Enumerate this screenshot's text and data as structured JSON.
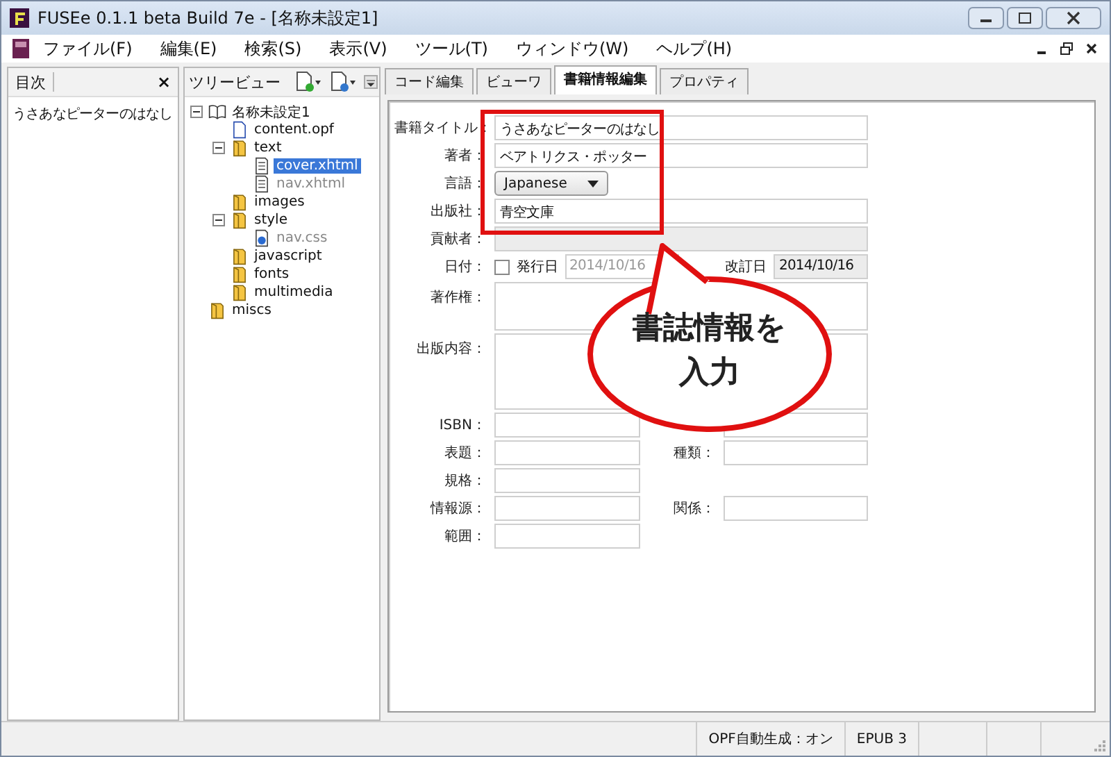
{
  "window": {
    "title": "FUSEe 0.1.1 beta Build 7e - [名称未設定1]"
  },
  "menu": [
    "ファイル(F)",
    "編集(E)",
    "検索(S)",
    "表示(V)",
    "ツール(T)",
    "ウィンドウ(W)",
    "ヘルプ(H)"
  ],
  "toc_pane": {
    "title": "目次",
    "close": "×",
    "items": [
      "うさあなピーターのはなし"
    ]
  },
  "tree_pane": {
    "title": "ツリービュー",
    "tree": [
      {
        "label": "名称未設定1",
        "kind": "book",
        "selected": false,
        "muted": false,
        "expanded": true,
        "children": [
          {
            "label": "content.opf",
            "kind": "file",
            "selected": false,
            "muted": false
          },
          {
            "label": "text",
            "kind": "folder",
            "selected": false,
            "muted": false,
            "expanded": true,
            "children": [
              {
                "label": "cover.xhtml",
                "kind": "page",
                "selected": true,
                "muted": false
              },
              {
                "label": "nav.xhtml",
                "kind": "page",
                "selected": false,
                "muted": true
              }
            ]
          },
          {
            "label": "images",
            "kind": "folder",
            "selected": false,
            "muted": false
          },
          {
            "label": "style",
            "kind": "folder",
            "selected": false,
            "muted": false,
            "expanded": true,
            "children": [
              {
                "label": "nav.css",
                "kind": "css",
                "selected": false,
                "muted": true
              }
            ]
          },
          {
            "label": "javascript",
            "kind": "folder",
            "selected": false,
            "muted": false
          },
          {
            "label": "fonts",
            "kind": "folder",
            "selected": false,
            "muted": false
          },
          {
            "label": "multimedia",
            "kind": "folder",
            "selected": false,
            "muted": false
          }
        ]
      },
      {
        "label": "miscs",
        "kind": "folder",
        "selected": false,
        "muted": false
      }
    ]
  },
  "tabs": [
    {
      "label": "コード編集",
      "selected": false
    },
    {
      "label": "ビューワ",
      "selected": false
    },
    {
      "label": "書籍情報編集",
      "selected": true
    },
    {
      "label": "プロパティ",
      "selected": false
    }
  ],
  "form": {
    "rows": [
      {
        "kind": "text",
        "label": "書籍タイトル：",
        "value": "うさあなピーターのはなし"
      },
      {
        "kind": "text",
        "label": "著者：",
        "value": "ベアトリクス・ポッター"
      },
      {
        "kind": "select",
        "label": "言語：",
        "value": "Japanese"
      },
      {
        "kind": "text",
        "label": "出版社：",
        "value": "青空文庫"
      },
      {
        "kind": "disabled",
        "label": "貢献者："
      },
      {
        "kind": "date",
        "label": "日付：",
        "checked": false,
        "issued_label": "発行日",
        "issued_value": "2014/10/16",
        "revised_label": "改訂日",
        "revised_value": "2014/10/16"
      },
      {
        "kind": "textarea",
        "label": "著作権：",
        "tall": false
      },
      {
        "kind": "textarea",
        "label": "出版内容：",
        "tall": true
      },
      {
        "kind": "pair",
        "cells": [
          {
            "kind": "labeled",
            "label": "ISBN："
          },
          {
            "kind": "unlabeled"
          }
        ]
      },
      {
        "kind": "pair",
        "cells": [
          {
            "kind": "labeled",
            "label": "表題："
          },
          {
            "kind": "labeled",
            "label": "種類："
          }
        ]
      },
      {
        "kind": "pair",
        "cells": [
          {
            "kind": "labeled",
            "label": "規格："
          }
        ]
      },
      {
        "kind": "pair",
        "cells": [
          {
            "kind": "labeled",
            "label": "情報源："
          },
          {
            "kind": "labeled",
            "label": "関係："
          }
        ]
      },
      {
        "kind": "pair",
        "cells": [
          {
            "kind": "labeled",
            "label": "範囲："
          }
        ]
      }
    ]
  },
  "callout": {
    "lines": [
      "書誌情報を",
      "入力"
    ]
  },
  "status_bar": {
    "cells": [
      "OPF自動生成：オン",
      "EPUB 3"
    ]
  }
}
